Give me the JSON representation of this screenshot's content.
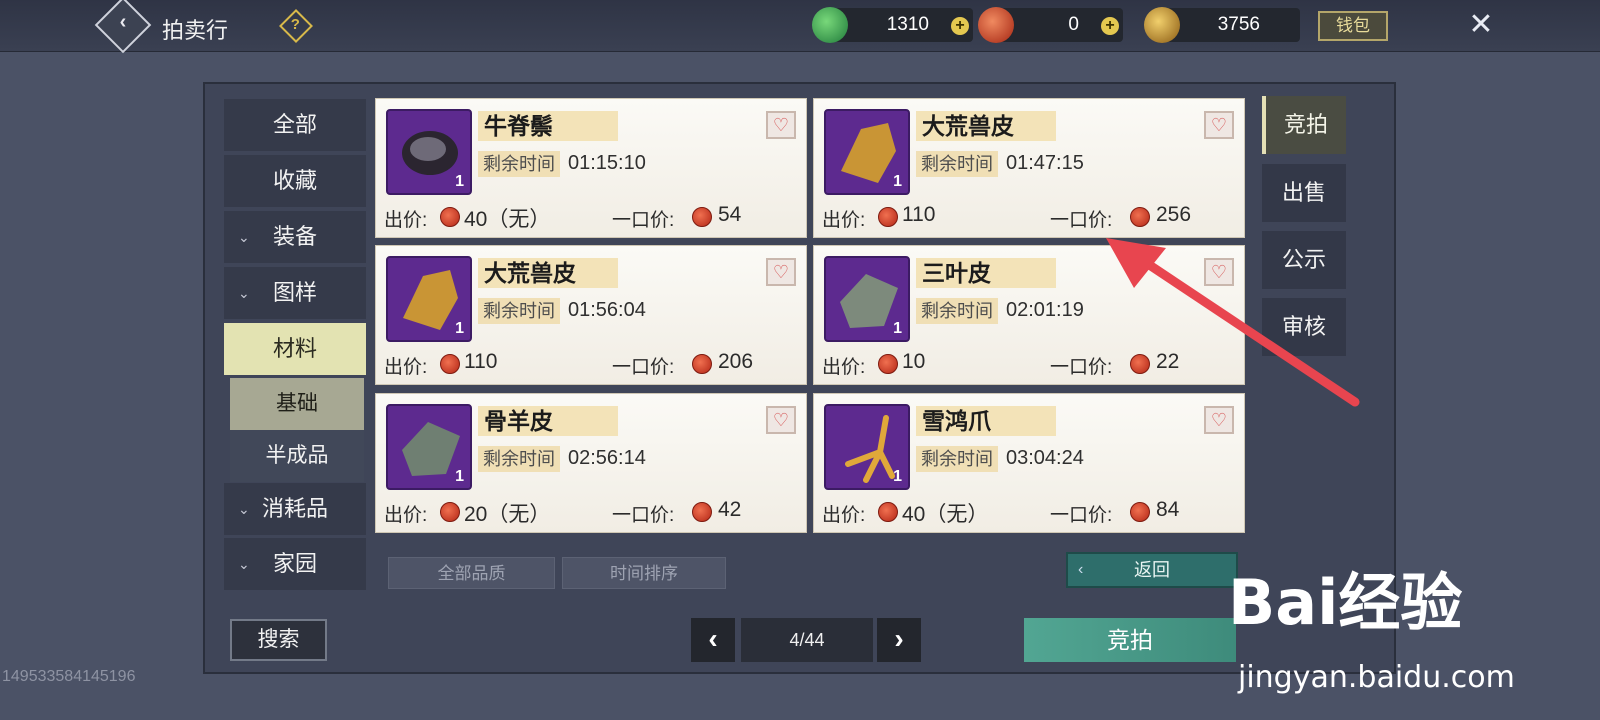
{
  "header": {
    "title": "拍卖行",
    "currencies": [
      {
        "name": "jade-currency",
        "amount": "1310",
        "color": "#3faa5a"
      },
      {
        "name": "red-coin-currency",
        "amount": "0",
        "color": "#c7432a"
      },
      {
        "name": "gold-ingot-currency",
        "amount": "3756",
        "color": "#c99a37"
      }
    ],
    "wallet_label": "钱包"
  },
  "sidebar": {
    "items": [
      {
        "label": "全部"
      },
      {
        "label": "收藏"
      },
      {
        "label": "装备"
      },
      {
        "label": "图样"
      },
      {
        "label": "材料"
      },
      {
        "label": "基础"
      },
      {
        "label": "半成品"
      },
      {
        "label": "消耗品"
      },
      {
        "label": "家园"
      }
    ]
  },
  "listings": [
    {
      "name": "牛脊鬃",
      "remain_label": "剩余时间",
      "remain_time": "01:15:10",
      "qty": "1",
      "bid_label": "出价:",
      "bid": "40（无）",
      "buy_label": "一口价:",
      "buy": "54"
    },
    {
      "name": "大荒兽皮",
      "remain_label": "剩余时间",
      "remain_time": "01:47:15",
      "qty": "1",
      "bid_label": "出价:",
      "bid": "110",
      "buy_label": "一口价:",
      "buy": "256"
    },
    {
      "name": "大荒兽皮",
      "remain_label": "剩余时间",
      "remain_time": "01:56:04",
      "qty": "1",
      "bid_label": "出价:",
      "bid": "110",
      "buy_label": "一口价:",
      "buy": "206"
    },
    {
      "name": "三叶皮",
      "remain_label": "剩余时间",
      "remain_time": "02:01:19",
      "qty": "1",
      "bid_label": "出价:",
      "bid": "10",
      "buy_label": "一口价:",
      "buy": "22"
    },
    {
      "name": "骨羊皮",
      "remain_label": "剩余时间",
      "remain_time": "02:56:14",
      "qty": "1",
      "bid_label": "出价:",
      "bid": "20（无）",
      "buy_label": "一口价:",
      "buy": "42"
    },
    {
      "name": "雪鸿爪",
      "remain_label": "剩余时间",
      "remain_time": "03:04:24",
      "qty": "1",
      "bid_label": "出价:",
      "bid": "40（无）",
      "buy_label": "一口价:",
      "buy": "84"
    }
  ],
  "tabs": [
    {
      "label": "竞拍"
    },
    {
      "label": "出售"
    },
    {
      "label": "公示"
    },
    {
      "label": "审核"
    }
  ],
  "filters": {
    "quality": "全部品质",
    "sort": "时间排序",
    "return_label": "返回"
  },
  "footer": {
    "search_label": "搜索",
    "page": "4/44",
    "bid_button": "竞拍",
    "player_id": "149533584145196"
  },
  "watermark": {
    "brand": "Bai经验",
    "site": "jingyan.baidu.com"
  }
}
